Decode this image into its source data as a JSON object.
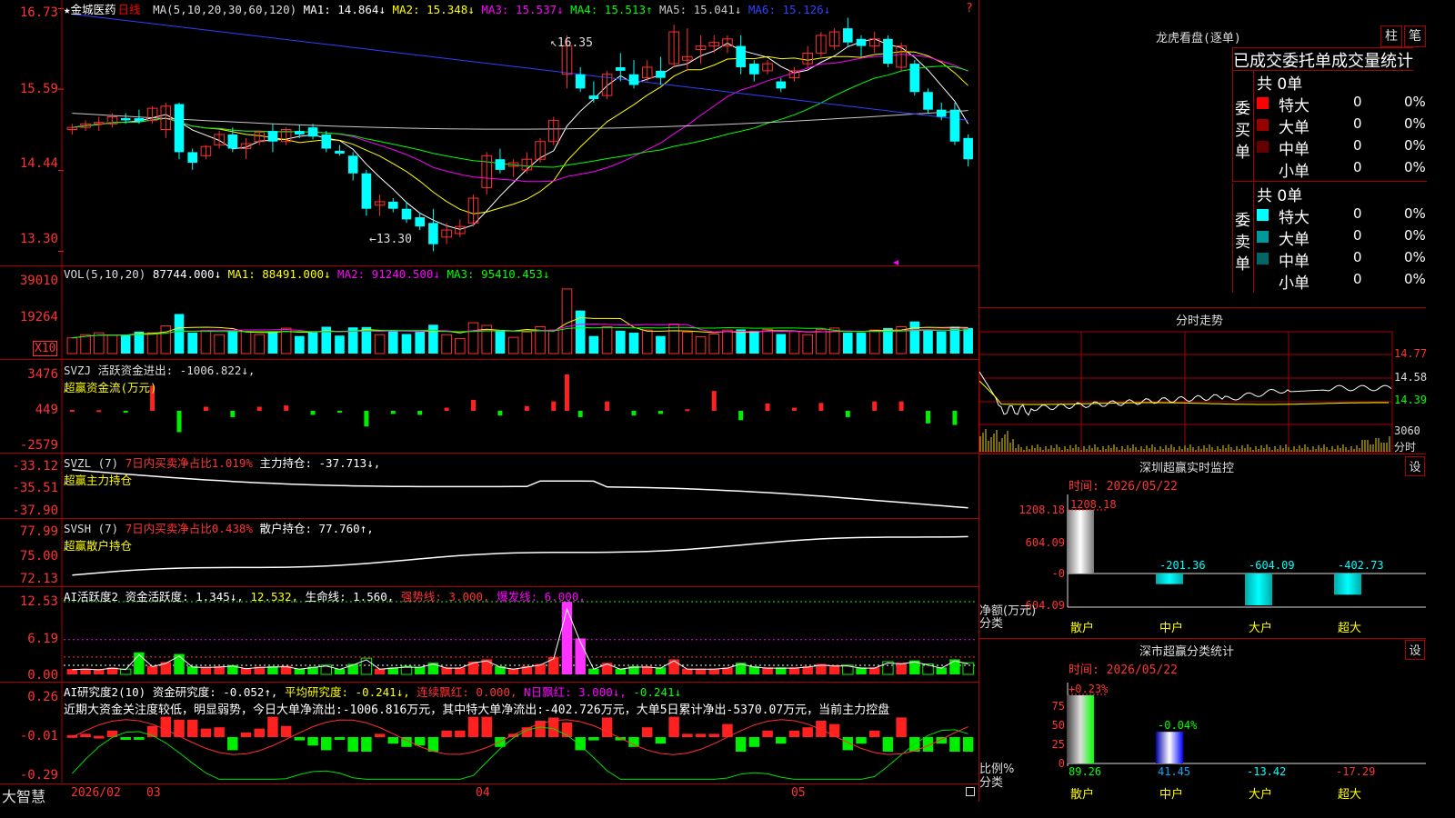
{
  "header": {
    "stock_name": "★金城医药",
    "period": "日线",
    "ma_params": "MA(5,10,20,30,60,120)",
    "ma_items": [
      {
        "label": "MA1: 14.864↓",
        "color": "#ffffff"
      },
      {
        "label": "MA2: 15.348↓",
        "color": "#ffff00"
      },
      {
        "label": "MA3: 15.537↓",
        "color": "#ff00ff"
      },
      {
        "label": "MA4: 15.513↑",
        "color": "#00ff00"
      },
      {
        "label": "MA5: 15.041↓",
        "color": "#c8c8c8"
      },
      {
        "label": "MA6: 15.126↓",
        "color": "#3040ff"
      }
    ]
  },
  "candle_panel": {
    "yticks": [
      "16.73",
      "15.59",
      "14.44",
      "13.30"
    ],
    "high_annot": "16.35",
    "low_annot": "13.30"
  },
  "vol_panel": {
    "title": "VOL(5,10,20)",
    "value": "87744.000↓",
    "ma_items": [
      {
        "label": "MA1: 88491.000↓",
        "color": "#ffff00"
      },
      {
        "label": "MA2: 91240.500↓",
        "color": "#ff00ff"
      },
      {
        "label": "MA3: 95410.453↓",
        "color": "#00ff00"
      }
    ],
    "yticks": [
      "39010",
      "19264"
    ],
    "unit": "X10"
  },
  "svzj_panel": {
    "title": "SVZJ  活跃资金进出: -1006.822↓,",
    "subtitle": "超赢资金流(万元)",
    "yticks": [
      "3476",
      "449",
      "-2579"
    ]
  },
  "svzl_panel": {
    "title": "SVZL (7)",
    "ratio": "7日内买卖净占比1.019%",
    "hold": "主力持仓: -37.713↓,",
    "subtitle": "超赢主力持仓",
    "yticks": [
      "-33.12",
      "-35.51",
      "-37.90"
    ]
  },
  "svsh_panel": {
    "title": "SVSH (7)",
    "ratio": "7日内买卖净占比0.438%",
    "hold": "散户持仓: 77.760↑,",
    "subtitle": "超赢散户持仓",
    "yticks": [
      "77.99",
      "75.00",
      "72.13"
    ]
  },
  "ai_active_panel": {
    "title": "AI活跃度2 资金活跃度: 1.345↓,",
    "v2": "12.532,",
    "v3": "生命线: 1.560,",
    "v4": "强势线: 3.000,",
    "v5": "爆发线: 6.000,",
    "yticks": [
      "12.53",
      "6.19",
      "0.00"
    ]
  },
  "ai_research_panel": {
    "title": "AI研究度2(10) 资金研究度: -0.052↑,",
    "v2": "平均研究度: -0.241↓,",
    "v3": "连续飘红: 0.000,",
    "v4": "N日飘红: 3.000↓,",
    "v5": "-0.241↓",
    "comment": "近期大资金关注度较低，明显弱势，今日大单净流出:-1006.816万元，其中特大单净流出:-402.726万元，大单5日累计净出-5370.07万元，当前主力控盘",
    "yticks": [
      "0.26",
      "-0.01",
      "-0.29"
    ]
  },
  "bottom_axis": {
    "brand": "大智慧",
    "dates": [
      "2026/02",
      "03",
      "04",
      "05"
    ]
  },
  "dragon_tiger": {
    "title": "龙虎看盘(逐单)",
    "btn_bar": "柱",
    "btn_pen": "笔",
    "tabs": [
      "已成交",
      "委托单",
      "成交量",
      "统计"
    ],
    "buy_label": "委买单",
    "buy_total": "共 0单",
    "sell_label": "委卖单",
    "sell_total": "共 0单",
    "buy_rows": [
      {
        "name": "特大",
        "count": "0",
        "pct": "0%",
        "color": "#ff0000"
      },
      {
        "name": "大单",
        "count": "0",
        "pct": "0%",
        "color": "#990000"
      },
      {
        "name": "中单",
        "count": "0",
        "pct": "0%",
        "color": "#660000"
      },
      {
        "name": "小单",
        "count": "0",
        "pct": "0%",
        "color": ""
      }
    ],
    "sell_rows": [
      {
        "name": "特大",
        "count": "0",
        "pct": "0%",
        "color": "#00ffff"
      },
      {
        "name": "大单",
        "count": "0",
        "pct": "0%",
        "color": "#009999"
      },
      {
        "name": "中单",
        "count": "0",
        "pct": "0%",
        "color": "#006666"
      },
      {
        "name": "小单",
        "count": "0",
        "pct": "0%",
        "color": ""
      }
    ]
  },
  "intraday": {
    "title": "分时走势",
    "yticks": [
      "14.77",
      "14.58",
      "14.39"
    ],
    "vol_tick": "3060",
    "vol_unit": "分时"
  },
  "sz_monitor": {
    "title": "深圳超赢实时监控",
    "set_btn": "设",
    "time_label": "时间: 2026/05/22",
    "yticks": [
      "1208.18",
      "604.09",
      "-0",
      "-604.09"
    ],
    "ylabel1": "净额(万元)",
    "ylabel2": "分类",
    "categories": [
      "散户",
      "中户",
      "大户",
      "超大"
    ],
    "values": [
      1208.18,
      -201.36,
      -604.09,
      -402.73
    ],
    "value_labels": [
      "1208.18",
      "-201.36",
      "-604.09",
      "-402.73"
    ]
  },
  "sz_class": {
    "title": "深市超赢分类统计",
    "set_btn": "设",
    "time_label": "时间: 2026/05/22",
    "yticks": [
      "75",
      "50",
      "25",
      "0"
    ],
    "ylabel1": "比例%",
    "ylabel2": "分类",
    "categories": [
      "散户",
      "中户",
      "大户",
      "超大"
    ],
    "change_labels": [
      "+0.23%",
      "-0.04%"
    ],
    "values": [
      89.26,
      41.45,
      -13.42,
      -17.29
    ],
    "value_labels": [
      "89.26",
      "41.45",
      "-13.42",
      "-17.29"
    ]
  },
  "chart_data": [
    {
      "type": "candlestick",
      "title": "★金城医药 日线",
      "x": [
        "2026/02",
        "03",
        "04",
        "05"
      ],
      "ylim": [
        13.3,
        16.73
      ],
      "ohlc_approx": [
        [
          15.02,
          15.1,
          14.95,
          15.05
        ],
        [
          15.05,
          15.15,
          15.0,
          15.1
        ],
        [
          15.1,
          15.2,
          15.0,
          15.12
        ],
        [
          15.1,
          15.25,
          15.05,
          15.2
        ],
        [
          15.18,
          15.25,
          15.1,
          15.15
        ],
        [
          15.18,
          15.3,
          15.1,
          15.14
        ],
        [
          15.15,
          15.35,
          15.1,
          15.32
        ],
        [
          15.02,
          15.4,
          14.9,
          15.35
        ],
        [
          15.38,
          15.4,
          14.6,
          14.7
        ],
        [
          14.7,
          14.75,
          14.45,
          14.55
        ],
        [
          14.65,
          14.8,
          14.6,
          14.78
        ],
        [
          14.8,
          15.0,
          14.75,
          14.95
        ],
        [
          14.95,
          15.05,
          14.7,
          14.75
        ],
        [
          14.75,
          14.9,
          14.6,
          14.82
        ],
        [
          14.85,
          15.0,
          14.8,
          14.98
        ],
        [
          15.0,
          15.1,
          14.7,
          14.85
        ],
        [
          14.85,
          15.05,
          14.8,
          15.02
        ],
        [
          15.0,
          15.08,
          14.9,
          14.95
        ],
        [
          15.05,
          15.1,
          14.88,
          14.92
        ],
        [
          14.95,
          15.0,
          14.7,
          14.75
        ],
        [
          14.72,
          14.8,
          14.65,
          14.68
        ],
        [
          14.65,
          14.7,
          14.3,
          14.4
        ],
        [
          14.4,
          14.45,
          13.8,
          13.9
        ],
        [
          13.95,
          14.1,
          13.8,
          14.0
        ],
        [
          14.0,
          14.05,
          13.85,
          13.9
        ],
        [
          13.9,
          14.0,
          13.7,
          13.75
        ],
        [
          13.78,
          13.85,
          13.6,
          13.65
        ],
        [
          13.7,
          13.9,
          13.3,
          13.4
        ],
        [
          13.5,
          13.7,
          13.4,
          13.6
        ],
        [
          13.55,
          13.75,
          13.5,
          13.65
        ],
        [
          13.7,
          14.1,
          13.65,
          14.05
        ],
        [
          14.2,
          14.7,
          14.1,
          14.65
        ],
        [
          14.6,
          14.75,
          14.4,
          14.45
        ],
        [
          14.5,
          14.6,
          14.35,
          14.55
        ],
        [
          14.45,
          14.7,
          14.4,
          14.6
        ],
        [
          14.6,
          14.9,
          14.55,
          14.85
        ],
        [
          14.85,
          15.2,
          14.8,
          15.15
        ],
        [
          15.8,
          16.35,
          15.6,
          16.2
        ],
        [
          15.8,
          15.9,
          15.55,
          15.6
        ],
        [
          15.5,
          15.7,
          15.4,
          15.45
        ],
        [
          15.5,
          15.85,
          15.45,
          15.8
        ],
        [
          15.9,
          16.1,
          15.7,
          15.85
        ],
        [
          15.8,
          16.0,
          15.6,
          15.65
        ],
        [
          15.75,
          16.0,
          15.7,
          15.9
        ],
        [
          15.85,
          16.05,
          15.65,
          15.75
        ],
        [
          15.95,
          16.5,
          15.9,
          16.4
        ],
        [
          16.0,
          16.45,
          15.85,
          16.05
        ],
        [
          16.15,
          16.35,
          15.95,
          16.2
        ],
        [
          16.2,
          16.35,
          16.1,
          16.25
        ],
        [
          16.2,
          16.35,
          16.1,
          16.3
        ],
        [
          16.2,
          16.35,
          15.8,
          15.9
        ],
        [
          15.95,
          16.0,
          15.7,
          15.8
        ],
        [
          15.85,
          16.0,
          15.8,
          15.95
        ],
        [
          15.7,
          15.75,
          15.55,
          15.6
        ],
        [
          15.75,
          15.9,
          15.7,
          15.85
        ],
        [
          15.95,
          16.2,
          15.9,
          16.1
        ],
        [
          16.1,
          16.4,
          16.05,
          16.35
        ],
        [
          16.2,
          16.45,
          16.15,
          16.4
        ],
        [
          16.45,
          16.6,
          16.2,
          16.25
        ],
        [
          16.3,
          16.35,
          16.05,
          16.2
        ],
        [
          16.2,
          16.4,
          16.1,
          16.3
        ],
        [
          16.3,
          16.35,
          15.9,
          15.95
        ],
        [
          15.9,
          16.25,
          15.85,
          16.2
        ],
        [
          15.95,
          16.0,
          15.5,
          15.55
        ],
        [
          15.55,
          15.6,
          15.25,
          15.3
        ],
        [
          15.3,
          15.4,
          15.15,
          15.2
        ],
        [
          15.3,
          15.4,
          14.8,
          14.85
        ],
        [
          14.9,
          14.95,
          14.5,
          14.6
        ]
      ]
    }
  ]
}
